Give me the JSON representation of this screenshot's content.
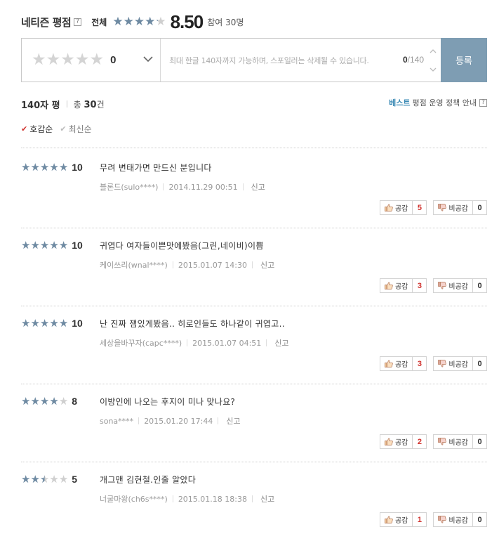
{
  "colors": {
    "star_filled": "#6e8aa2",
    "star_empty": "#cfcfcf",
    "submit_bg": "#7e9db3",
    "accent_red": "#d0312d",
    "best_blue": "#3a8ab4"
  },
  "header": {
    "title": "네티즌 평점",
    "help": "?",
    "total_label": "전체",
    "average": "8.50",
    "average_value": 8.5,
    "participants": "참여 30명"
  },
  "input": {
    "rating": "0",
    "placeholder": "최대 한글 140자까지 가능하며, 스포일러는 삭제될 수 있습니다.",
    "count_current": "0",
    "count_max": "/140",
    "submit_label": "등록"
  },
  "meta": {
    "title": "140자 평",
    "total_prefix": "총",
    "total_count": "30",
    "total_suffix": "건",
    "policy_best": "베스트",
    "policy_text": "평점 운영 정책 안내",
    "policy_help": "?"
  },
  "sort": [
    {
      "label": "호감순",
      "active": true
    },
    {
      "label": "최신순",
      "active": false
    }
  ],
  "reviews": [
    {
      "stars": 5,
      "score": "10",
      "text": "무려 변태가면 만드신 분입니다",
      "author": "블론드(sulo****)",
      "date": "2014.11.29 00:51",
      "report": "신고",
      "like_label": "공감",
      "likes": "5",
      "dislike_label": "비공감",
      "dislikes": "0"
    },
    {
      "stars": 5,
      "score": "10",
      "text": "귀엽다 여자들이쁜맛에봤음(그린,네이비)이쁨",
      "author": "케이쓰리(wnal****)",
      "date": "2015.01.07 14:30",
      "report": "신고",
      "like_label": "공감",
      "likes": "3",
      "dislike_label": "비공감",
      "dislikes": "0"
    },
    {
      "stars": 5,
      "score": "10",
      "text": "난 진짜 잼있게봤음.. 히로인들도 하나같이 귀엽고..",
      "author": "세상을바꾸자(capc****)",
      "date": "2015.01.07 04:51",
      "report": "신고",
      "like_label": "공감",
      "likes": "3",
      "dislike_label": "비공감",
      "dislikes": "0"
    },
    {
      "stars": 4,
      "score": "8",
      "text": "이방인에 나오는 후지이 미나 맞나요?",
      "author": "sona****",
      "date": "2015.01.20 17:44",
      "report": "신고",
      "like_label": "공감",
      "likes": "2",
      "dislike_label": "비공감",
      "dislikes": "0"
    },
    {
      "stars": 2.5,
      "score": "5",
      "text": "개그맨 김현철.인줄 알았다",
      "author": "너굴마왕(ch6s****)",
      "date": "2015.01.18 18:38",
      "report": "신고",
      "like_label": "공감",
      "likes": "1",
      "dislike_label": "비공감",
      "dislikes": "0"
    }
  ]
}
